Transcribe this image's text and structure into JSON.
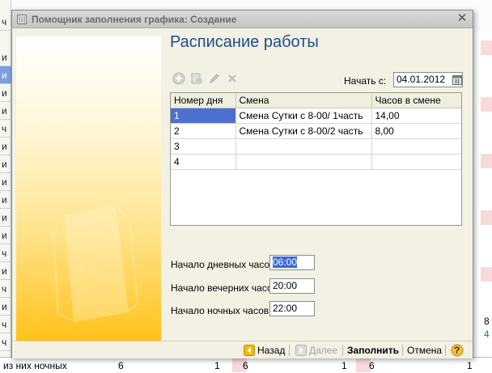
{
  "background": {
    "left_rows": [
      "ч",
      "и",
      "и",
      "и",
      "и",
      "ч",
      "и",
      "и",
      "и",
      "и",
      "и",
      "и",
      "ч",
      "и",
      "ч",
      "и",
      "ч",
      "ч",
      "и"
    ],
    "bottom_row": {
      "label": "из них ночных",
      "v1": "6",
      "v2": "1",
      "v3": "6",
      "v4": "1",
      "v5": "6",
      "v6": "1"
    },
    "right_values": [
      "8",
      "4"
    ]
  },
  "dialog": {
    "title": "Помощник заполнения графика: Создание",
    "close_glyph": "✕",
    "heading": "Расписание работы",
    "start_label": "Начать с:",
    "start_date": "04.01.2012",
    "grid": {
      "columns": [
        "Номер дня",
        "Смена",
        "Часов в смене"
      ],
      "rows": [
        [
          "1",
          "Смена Сутки с 8-00/ 1часть",
          "14,00"
        ],
        [
          "2",
          "Смена Сутки с 8-00/2 часть",
          "8,00"
        ],
        [
          "3",
          "",
          ""
        ],
        [
          "4",
          "",
          ""
        ]
      ]
    },
    "times": {
      "day_label": "Начало дневных часов:",
      "day_value": "06:00",
      "evening_label": "Начало вечерних часов:",
      "evening_value": "20:00",
      "night_label": "Начало ночных часов:",
      "night_value": "22:00"
    },
    "footer": {
      "back": "Назад",
      "next": "Далее",
      "fill": "Заполнить",
      "cancel": "Отмена",
      "help": "?"
    }
  },
  "colors": {
    "heading": "#1f4d8c",
    "selection": "#4d6fd0",
    "dialog_bg": "#f2f1e4"
  },
  "icons": [
    "app-icon",
    "add-icon",
    "copy-icon",
    "edit-icon",
    "delete-icon",
    "calendar-icon",
    "back-arrow-icon",
    "next-arrow-icon",
    "help-icon"
  ]
}
